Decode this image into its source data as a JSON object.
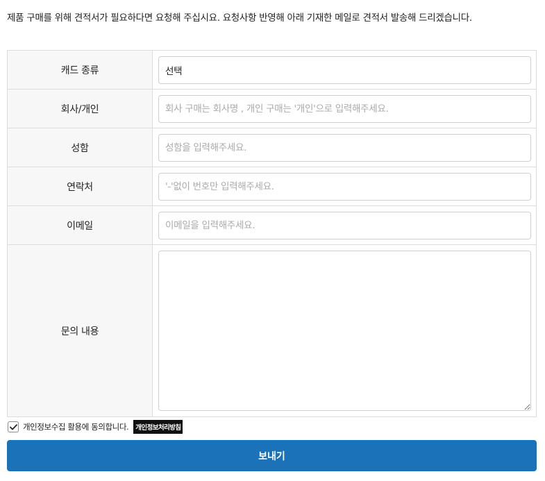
{
  "intro": {
    "text": "제품 구매를 위해 견적서가 필요하다면 요청해 주십시요. 요청사항 반영해 아래 기재한 메일로 견적서 발송해 드리겠습니다."
  },
  "form": {
    "card_type": {
      "label": "캐드 종류",
      "value": "선택"
    },
    "company": {
      "label": "회사/개인",
      "placeholder": "회사 구매는 회사명 , 개인 구매는 '개인'으로 입력해주세요."
    },
    "name": {
      "label": "성함",
      "placeholder": "성함을 입력해주세요."
    },
    "phone": {
      "label": "연락처",
      "placeholder": "'-'없이 번호만 입력해주세요."
    },
    "email": {
      "label": "이메일",
      "placeholder": "이메일을 입력해주세요."
    },
    "message": {
      "label": "문의 내용",
      "value": ""
    }
  },
  "agreement": {
    "checked": true,
    "text": "개인정보수집 활용에 동의합니다.",
    "policy_button": "개인정보처리방침"
  },
  "submit": {
    "label": "보내기"
  },
  "colors": {
    "primary": "#1a72b8",
    "label_bg": "#f7f7f7",
    "border": "#dcdcdc"
  },
  "icons": {
    "checkbox": "checkmark-icon"
  }
}
